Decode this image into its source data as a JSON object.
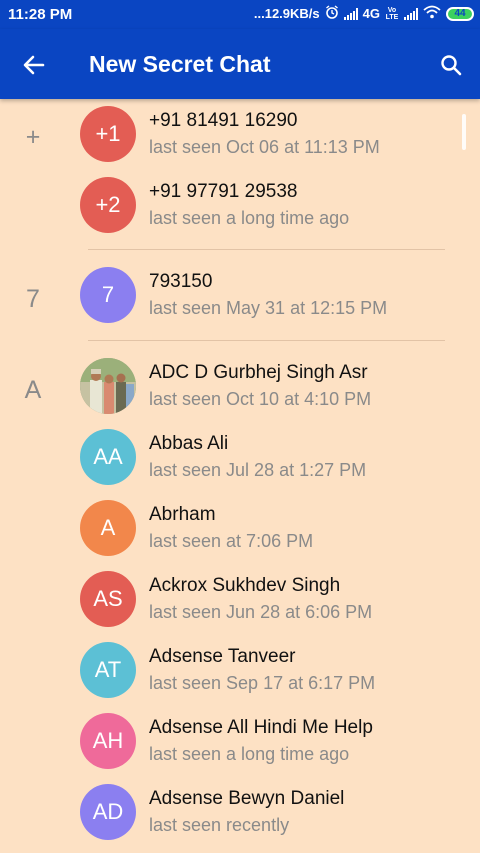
{
  "statusbar": {
    "time": "11:28 PM",
    "net_speed": "...12.9KB/s",
    "network": "4G",
    "volte": "Vo LTE",
    "battery": "44"
  },
  "appbar": {
    "title": "New Secret Chat",
    "back_icon": "arrow-left",
    "search_icon": "search"
  },
  "sections": {
    "plus": "+",
    "seven": "7",
    "a": "A"
  },
  "contacts": [
    {
      "initials": "+1",
      "name": "+91 81491 16290",
      "status": "last seen Oct 06 at 11:13 PM",
      "color": "#e35d54"
    },
    {
      "initials": "+2",
      "name": "+91 97791 29538",
      "status": "last seen a long time ago",
      "color": "#e35d54"
    },
    {
      "initials": "7",
      "name": "793150",
      "status": "last seen May 31 at 12:15 PM",
      "color": "#8b7ff0"
    },
    {
      "initials": "",
      "name": "ADC D Gurbhej Singh Asr",
      "status": "last seen Oct 10 at 4:10 PM",
      "color": "#7a8a6a"
    },
    {
      "initials": "AA",
      "name": "Abbas Ali",
      "status": "last seen Jul 28 at 1:27 PM",
      "color": "#5cc0d5"
    },
    {
      "initials": "A",
      "name": "Abrham",
      "status": "last seen at 7:06 PM",
      "color": "#f2874b"
    },
    {
      "initials": "AS",
      "name": "Ackrox Sukhdev Singh",
      "status": "last seen Jun 28 at 6:06 PM",
      "color": "#e35d54"
    },
    {
      "initials": "AT",
      "name": "Adsense Tanveer",
      "status": "last seen Sep 17 at 6:17 PM",
      "color": "#5cc0d5"
    },
    {
      "initials": "AH",
      "name": "Adsense All Hindi Me Help",
      "status": "last seen a long time ago",
      "color": "#ef6a9a"
    },
    {
      "initials": "AD",
      "name": "Adsense Bewyn Daniel",
      "status": "last seen recently",
      "color": "#8b7ff0"
    }
  ]
}
